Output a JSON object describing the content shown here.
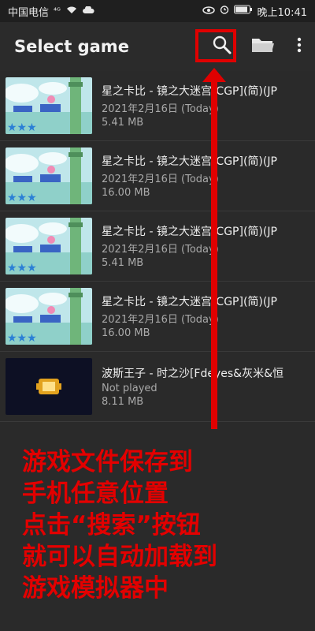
{
  "status_bar": {
    "carrier": "中国电信",
    "signal": "⁴ᴳ",
    "time": "晚上10:41"
  },
  "app_bar": {
    "title": "Select game",
    "search_icon": "search-icon",
    "folder_icon": "folder-icon",
    "menu_icon": "more-vert-icon"
  },
  "games": [
    {
      "name": "星之卡比 - 镜之大迷宫[CGP](简)(JP",
      "date": "2021年2月16日 (Today)",
      "size": "5.41 MB",
      "thumb": "kirby"
    },
    {
      "name": "星之卡比 - 镜之大迷宫[CGP](简)(JP",
      "date": "2021年2月16日 (Today)",
      "size": "16.00 MB",
      "thumb": "kirby"
    },
    {
      "name": "星之卡比 - 镜之大迷宫[CGP](简)(JP",
      "date": "2021年2月16日 (Today)",
      "size": "5.41 MB",
      "thumb": "kirby"
    },
    {
      "name": "星之卡比 - 镜之大迷宫[CGP](简)(JP",
      "date": "2021年2月16日 (Today)",
      "size": "16.00 MB",
      "thumb": "kirby"
    },
    {
      "name": "波斯王子 - 时之沙[Fdeyes&灰米&恒",
      "date": "Not played",
      "size": "8.11 MB",
      "thumb": "gba"
    }
  ],
  "overlay_text": [
    "游戏文件保存到",
    "手机任意位置",
    "点击“搜索”按钮",
    "就可以自动加载到",
    "游戏模拟器中"
  ]
}
